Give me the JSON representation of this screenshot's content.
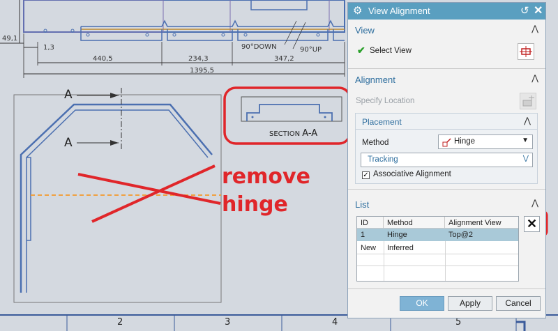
{
  "drawing": {
    "dims": {
      "d49": "49,1",
      "d13": "1,3",
      "d4405": "440,5",
      "d2343": "234,3",
      "d3472": "347,2",
      "d13955": "1395,5",
      "down": "90°DOWN",
      "up": "90°UP"
    },
    "section_letter_top": "A",
    "section_letter_bottom": "A",
    "section_label_prefix": "SECTION",
    "section_label_name": "A-A",
    "zone_numbers": [
      "2",
      "3",
      "4",
      "5"
    ]
  },
  "annotation": {
    "line1": "remove",
    "line2": "hinge",
    "color": "#e0262a"
  },
  "dialog": {
    "title": "View Alignment",
    "view_section": "View",
    "select_view": "Select View",
    "alignment_section": "Alignment",
    "specify_location": "Specify Location",
    "placement_section": "Placement",
    "method_label": "Method",
    "method_value": "Hinge",
    "tracking_value": "Tracking",
    "associative_label": "Associative Alignment",
    "associative_checked": true,
    "list_section": "List",
    "list_columns": [
      "ID",
      "Method",
      "Alignment View"
    ],
    "list_rows": [
      {
        "id": "1",
        "method": "Hinge",
        "view": "Top@2",
        "selected": true
      },
      {
        "id": "New",
        "method": "Inferred",
        "view": "",
        "selected": false
      }
    ],
    "ok": "OK",
    "apply": "Apply",
    "cancel": "Cancel",
    "accent": "#5a9fc0"
  }
}
